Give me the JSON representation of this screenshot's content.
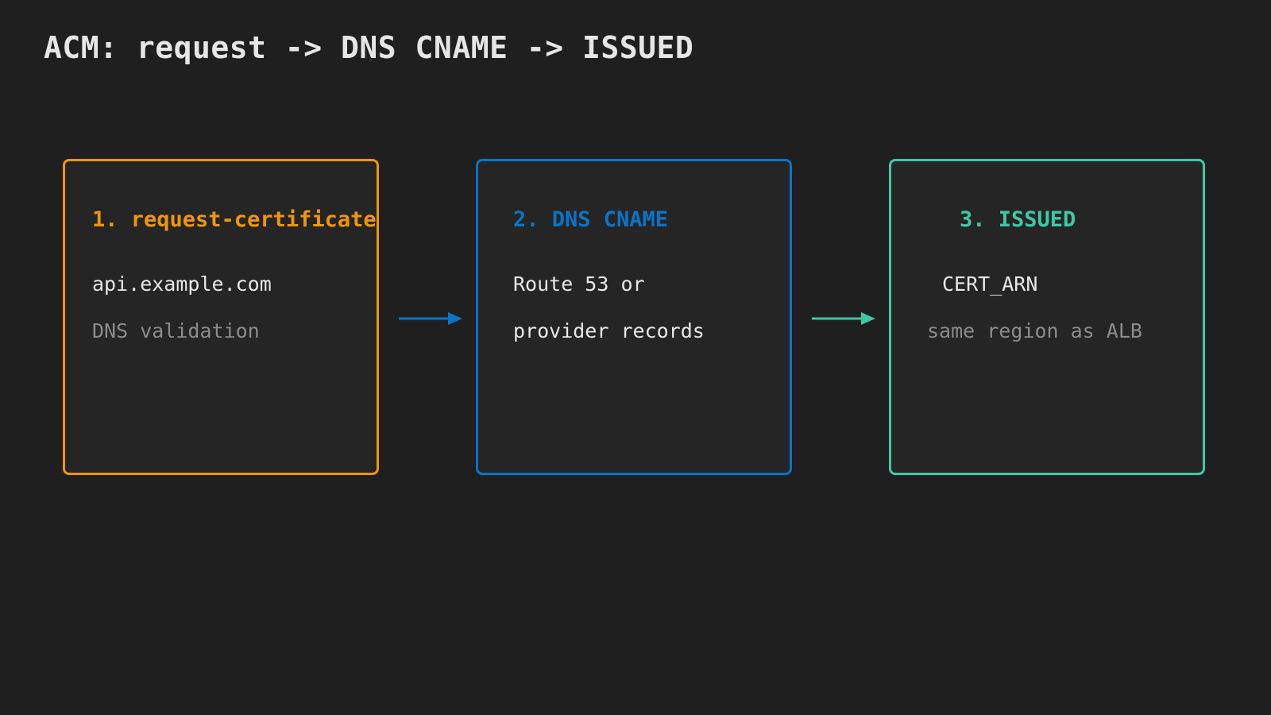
{
  "title": "ACM: request -> DNS CNAME -> ISSUED",
  "colors": {
    "background": "#1f1f1f",
    "step1": "#f0950c",
    "step2": "#0a74c8",
    "step3": "#3cc9a6",
    "text": "#e8e8e8",
    "muted": "#8c8c8c"
  },
  "steps": [
    {
      "title": "1. request-certificate",
      "line1": "api.example.com",
      "line2": "DNS validation"
    },
    {
      "title": "2. DNS CNAME",
      "line1": "Route 53 or",
      "line2": "provider records"
    },
    {
      "title": "3. ISSUED",
      "line1": "CERT_ARN",
      "line2": "same region as ALB"
    }
  ],
  "arrows": [
    {
      "from": "step-1",
      "to": "step-2",
      "color": "#0a74c8"
    },
    {
      "from": "step-2",
      "to": "step-3",
      "color": "#3cc9a6"
    }
  ]
}
